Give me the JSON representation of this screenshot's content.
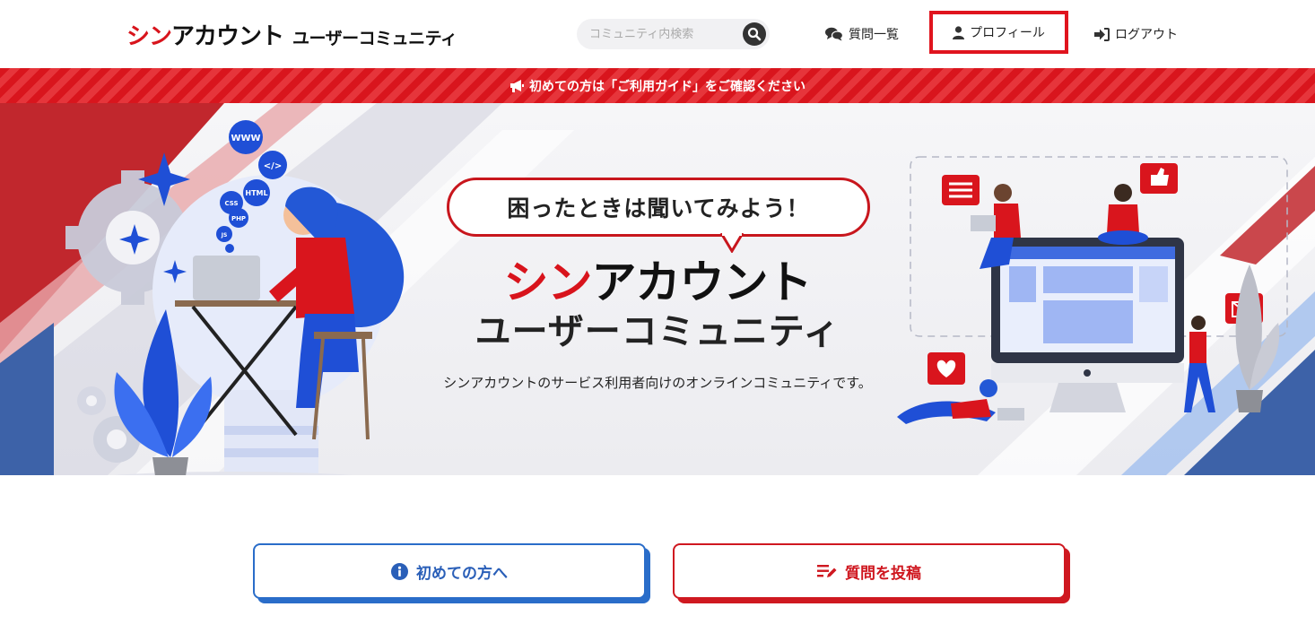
{
  "header": {
    "logo": {
      "red": "シン",
      "black": "アカウント",
      "sub": "ユーザーコミュニティ"
    },
    "search": {
      "placeholder": "コミュニティ内検索"
    },
    "nav": {
      "questions": "質問一覧",
      "profile": "プロフィール",
      "logout": "ログアウト"
    }
  },
  "notice": {
    "text": "初めての方は「ご利用ガイド」をご確認ください"
  },
  "hero": {
    "bubble": "困ったときは聞いてみよう！",
    "title_red": "シン",
    "title_black": "アカウント",
    "title2": "ユーザーコミュニティ",
    "description": "シンアカウントのサービス利用者向けのオンラインコミュニティです。",
    "illustration_tags": [
      "WWW",
      "</>",
      "HTML",
      "CSS",
      "PHP",
      "JS"
    ]
  },
  "buttons": {
    "first_time": "初めての方へ",
    "post_question": "質問を投稿"
  },
  "colors": {
    "brand_red": "#d8141c",
    "brand_blue": "#2a6dc9"
  }
}
